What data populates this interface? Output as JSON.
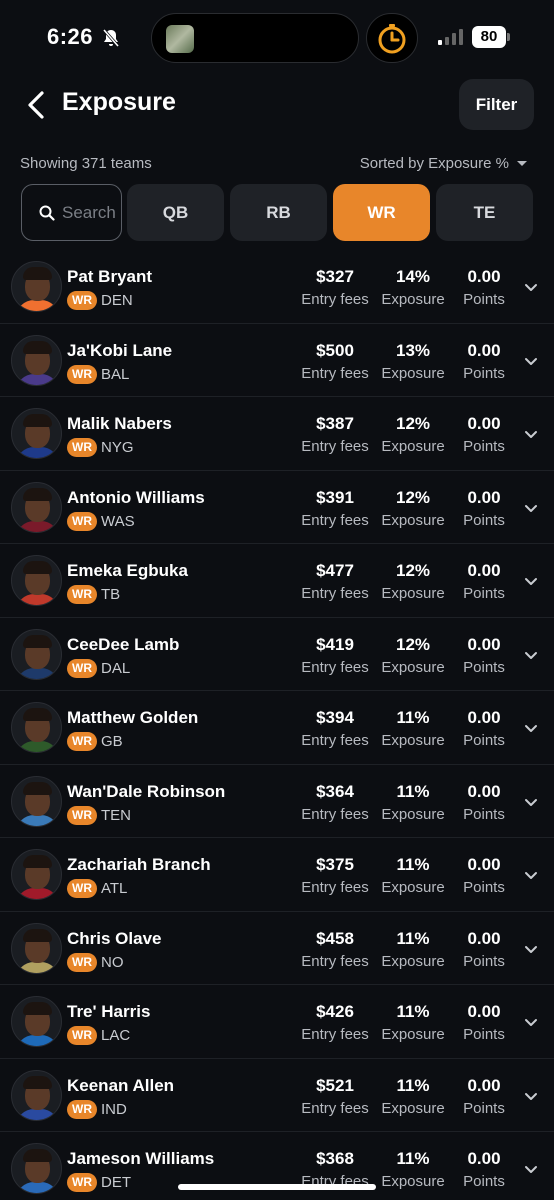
{
  "status_bar": {
    "time": "6:26",
    "battery": "80"
  },
  "header": {
    "title": "Exposure",
    "filter_label": "Filter"
  },
  "summary": {
    "showing": "Showing 371 teams",
    "sorted": "Sorted by Exposure %"
  },
  "search": {
    "placeholder": "Search"
  },
  "tabs": [
    {
      "label": "QB",
      "active": false
    },
    {
      "label": "RB",
      "active": false
    },
    {
      "label": "WR",
      "active": true
    },
    {
      "label": "TE",
      "active": false
    }
  ],
  "labels": {
    "fees": "Entry fees",
    "exposure": "Exposure",
    "points": "Points"
  },
  "colors": {
    "accent": "#e8862a",
    "background": "#0c0e12",
    "card": "#1f2227"
  },
  "players": [
    {
      "name": "Pat Bryant",
      "pos": "WR",
      "team": "DEN",
      "fees": "$327",
      "exposure": "14%",
      "points": "0.00"
    },
    {
      "name": "Ja'Kobi Lane",
      "pos": "WR",
      "team": "BAL",
      "fees": "$500",
      "exposure": "13%",
      "points": "0.00"
    },
    {
      "name": "Malik Nabers",
      "pos": "WR",
      "team": "NYG",
      "fees": "$387",
      "exposure": "12%",
      "points": "0.00"
    },
    {
      "name": "Antonio Williams",
      "pos": "WR",
      "team": "WAS",
      "fees": "$391",
      "exposure": "12%",
      "points": "0.00"
    },
    {
      "name": "Emeka Egbuka",
      "pos": "WR",
      "team": "TB",
      "fees": "$477",
      "exposure": "12%",
      "points": "0.00"
    },
    {
      "name": "CeeDee Lamb",
      "pos": "WR",
      "team": "DAL",
      "fees": "$419",
      "exposure": "12%",
      "points": "0.00"
    },
    {
      "name": "Matthew Golden",
      "pos": "WR",
      "team": "GB",
      "fees": "$394",
      "exposure": "11%",
      "points": "0.00"
    },
    {
      "name": "Wan'Dale Robinson",
      "pos": "WR",
      "team": "TEN",
      "fees": "$364",
      "exposure": "11%",
      "points": "0.00"
    },
    {
      "name": "Zachariah Branch",
      "pos": "WR",
      "team": "ATL",
      "fees": "$375",
      "exposure": "11%",
      "points": "0.00"
    },
    {
      "name": "Chris Olave",
      "pos": "WR",
      "team": "NO",
      "fees": "$458",
      "exposure": "11%",
      "points": "0.00"
    },
    {
      "name": "Tre' Harris",
      "pos": "WR",
      "team": "LAC",
      "fees": "$426",
      "exposure": "11%",
      "points": "0.00"
    },
    {
      "name": "Keenan Allen",
      "pos": "WR",
      "team": "IND",
      "fees": "$521",
      "exposure": "11%",
      "points": "0.00"
    },
    {
      "name": "Jameson Williams",
      "pos": "WR",
      "team": "DET",
      "fees": "$368",
      "exposure": "11%",
      "points": "0.00"
    }
  ]
}
